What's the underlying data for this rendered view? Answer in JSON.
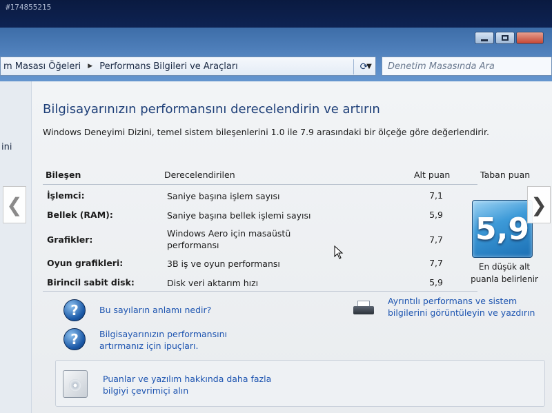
{
  "photo": {
    "id_label": "#174855215"
  },
  "window": {
    "controls": [
      "minimize",
      "maximize",
      "close"
    ]
  },
  "address_bar": {
    "crumbs": [
      "m Masası Öğeleri",
      "Performans Bilgileri ve Araçları"
    ],
    "search_placeholder": "Denetim Masasında Ara"
  },
  "left_pane": {
    "snippet": "ini"
  },
  "page": {
    "title": "Bilgisayarınızın performansını derecelendirin ve artırın",
    "description": "Windows Deneyimi Dizini, temel sistem bileşenlerini 1.0 ile 7.9 arasındaki bir ölçeğe göre değerlendirir."
  },
  "table": {
    "headers": {
      "component": "Bileşen",
      "rated": "Derecelendirilen",
      "subscore": "Alt puan",
      "base": "Taban puan"
    },
    "rows": [
      {
        "component": "İşlemci:",
        "description": "Saniye başına işlem sayısı",
        "score": "7,1"
      },
      {
        "component": "Bellek (RAM):",
        "description": "Saniye başına bellek işlemi sayısı",
        "score": "5,9"
      },
      {
        "component": "Grafikler:",
        "description": "Windows Aero için masaüstü performansı",
        "score": "7,7"
      },
      {
        "component": "Oyun grafikleri:",
        "description": "3B iş ve oyun performansı",
        "score": "7,7"
      },
      {
        "component": "Birincil sabit disk:",
        "description": "Disk veri aktarım hızı",
        "score": "5,9"
      }
    ],
    "base_score": "5,9",
    "base_caption": "En düşük alt puanla belirlenir"
  },
  "links": {
    "what_mean": "Bu sayıların anlamı nedir?",
    "tips": "Bilgisayarınızın performansını artırmanız için ipuçları.",
    "details": "Ayrıntılı performans ve sistem bilgilerini görüntüleyin ve yazdırın",
    "online": "Puanlar ve yazılım hakkında daha fazla bilgiyi çevrimiçi alın"
  },
  "nav": {
    "prev_glyph": "❮",
    "next_glyph": "❯"
  },
  "colors": {
    "title": "#1e3f78",
    "link": "#1d54b0",
    "badge": "#1b6fb4",
    "frame": "#6f9fd6"
  }
}
